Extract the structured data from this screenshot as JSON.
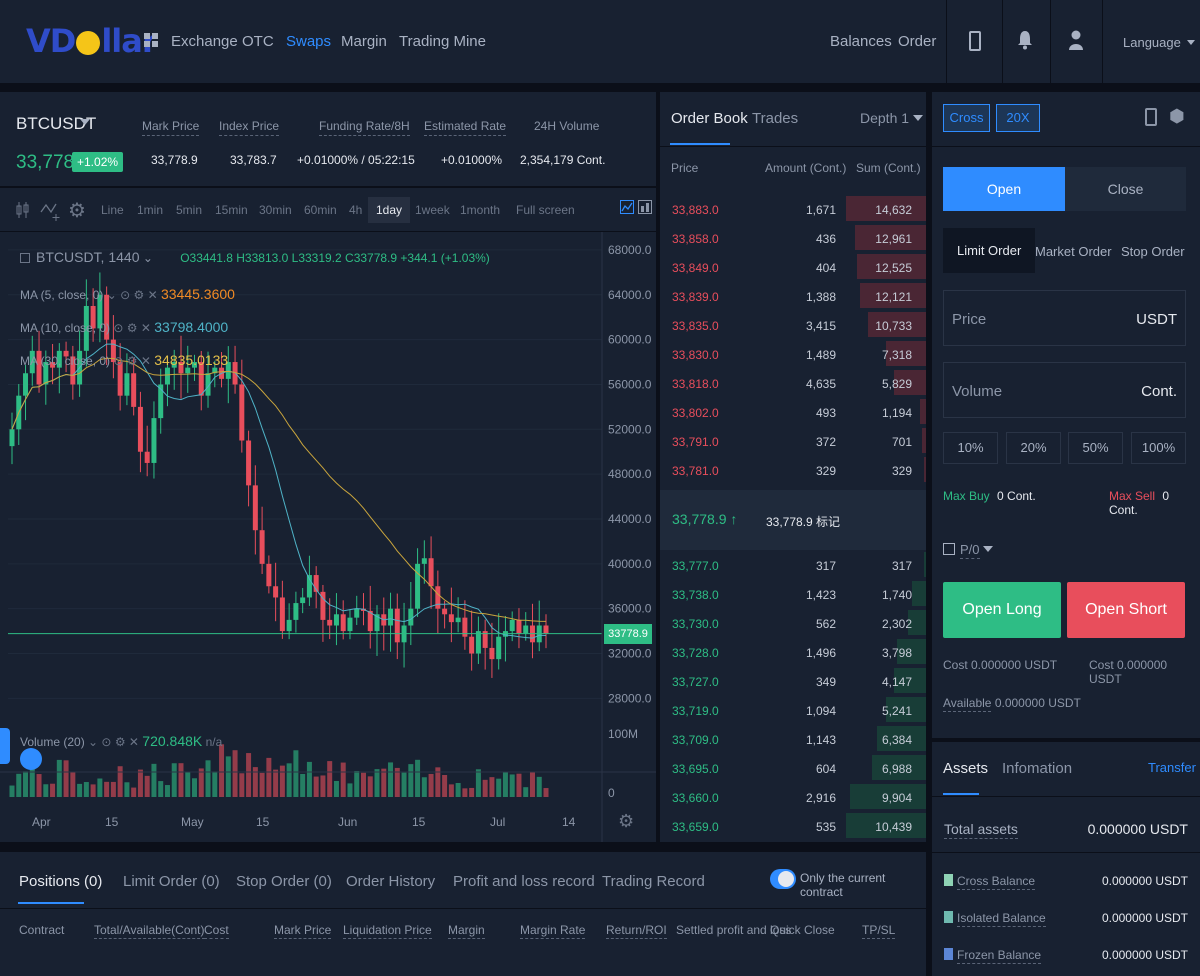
{
  "nav": {
    "logo_left": "VD",
    "logo_right": "llar",
    "links": [
      "Exchange",
      "OTC",
      "Swaps",
      "Margin",
      "Trading Mine"
    ],
    "active": "Swaps",
    "right_links": [
      "Balances",
      "Order"
    ],
    "language": "Language",
    "icons": [
      "grid-icon",
      "mobile-icon",
      "bell-icon",
      "user-icon",
      "caret-down-icon"
    ]
  },
  "ticker": {
    "symbol": "BTCUSDT",
    "last_price": "33,778.9",
    "change": "+1.02%",
    "stats": [
      {
        "label": "Mark Price",
        "value": "33,778.9"
      },
      {
        "label": "Index Price",
        "value": "33,783.7"
      },
      {
        "label": "Funding Rate/8H",
        "value": "+0.01000% / 05:22:15"
      },
      {
        "label": "Estimated Rate",
        "value": "+0.01000%"
      },
      {
        "label": "24H Volume",
        "value": "2,354,179 Cont."
      }
    ]
  },
  "chart_toolbar": {
    "intervals": [
      "Line",
      "1min",
      "5min",
      "15min",
      "30min",
      "60min",
      "4h",
      "1day",
      "1week",
      "1month",
      "Full screen"
    ],
    "active": "1day"
  },
  "chart_legend": {
    "title": "BTCUSDT, 1440",
    "ohlc": "O33441.8  H33813.0  L33319.2  C33778.9  +344.1 (+1.03%)",
    "ma5_label": "MA (5, close, 0)",
    "ma5_value": "33445.3600",
    "ma10_label": "MA (10, close, 0)",
    "ma10_value": "33798.4000",
    "ma30_label": "MA (30, close, 0)",
    "ma30_value": "34835.0133",
    "volume_label": "Volume (20)",
    "volume_value": "720.848K",
    "volume_extra": "n/a",
    "price_tag": "33778.9"
  },
  "chart_data": {
    "type": "candlestick",
    "y_ticks": [
      "68000.0",
      "64000.0",
      "60000.0",
      "56000.0",
      "52000.0",
      "48000.0",
      "44000.0",
      "40000.0",
      "36000.0",
      "32000.0",
      "28000.0"
    ],
    "ylim": [
      25000,
      69600
    ],
    "volume_ticks": [
      "100M",
      "0"
    ],
    "x_ticks": [
      "Apr",
      "15",
      "May",
      "15",
      "Jun",
      "15",
      "Jul",
      "14"
    ],
    "close_path": [
      52000,
      55000,
      57000,
      59000,
      56000,
      58000,
      57500,
      59000,
      58500,
      56000,
      59000,
      63000,
      61000,
      64000,
      60000,
      58000,
      55000,
      57000,
      54000,
      50000,
      49000,
      53000,
      56000,
      57500,
      58000,
      57000,
      57500,
      58000,
      55000,
      57000,
      57500,
      56500,
      58000,
      56000,
      51000,
      47000,
      43000,
      40000,
      38000,
      37000,
      34000,
      35000,
      36500,
      37000,
      39000,
      37500,
      35000,
      34500,
      35500,
      34000,
      35200,
      36000,
      35800,
      34000,
      35500,
      34500,
      36000,
      33000,
      34500,
      36000,
      40000,
      40500,
      38000,
      36000,
      35500,
      34800,
      35200,
      33500,
      32000,
      34000,
      32500,
      31500,
      33500,
      34000,
      35000,
      33800,
      34500,
      33000,
      34500,
      33778.9
    ]
  },
  "orderbook": {
    "tabs": [
      "Order Book",
      "Trades"
    ],
    "depth": "Depth 1",
    "headers": [
      "Price",
      "Amount (Cont.)",
      "Sum (Cont.)"
    ],
    "asks": [
      {
        "price": "33,883.0",
        "amount": "1,671",
        "sum": "14,632",
        "depth": 1.0
      },
      {
        "price": "33,858.0",
        "amount": "436",
        "sum": "12,961",
        "depth": 0.89
      },
      {
        "price": "33,849.0",
        "amount": "404",
        "sum": "12,525",
        "depth": 0.86
      },
      {
        "price": "33,839.0",
        "amount": "1,388",
        "sum": "12,121",
        "depth": 0.83
      },
      {
        "price": "33,835.0",
        "amount": "3,415",
        "sum": "10,733",
        "depth": 0.73
      },
      {
        "price": "33,830.0",
        "amount": "1,489",
        "sum": "7,318",
        "depth": 0.5
      },
      {
        "price": "33,818.0",
        "amount": "4,635",
        "sum": "5,829",
        "depth": 0.4
      },
      {
        "price": "33,802.0",
        "amount": "493",
        "sum": "1,194",
        "depth": 0.08
      },
      {
        "price": "33,791.0",
        "amount": "372",
        "sum": "701",
        "depth": 0.05
      },
      {
        "price": "33,781.0",
        "amount": "329",
        "sum": "329",
        "depth": 0.02
      }
    ],
    "mid_price": "33,778.9",
    "mid_mark": "33,778.9 标记",
    "bids": [
      {
        "price": "33,777.0",
        "amount": "317",
        "sum": "317",
        "depth": 0.03
      },
      {
        "price": "33,738.0",
        "amount": "1,423",
        "sum": "1,740",
        "depth": 0.17
      },
      {
        "price": "33,730.0",
        "amount": "562",
        "sum": "2,302",
        "depth": 0.22
      },
      {
        "price": "33,728.0",
        "amount": "1,496",
        "sum": "3,798",
        "depth": 0.36
      },
      {
        "price": "33,727.0",
        "amount": "349",
        "sum": "4,147",
        "depth": 0.4
      },
      {
        "price": "33,719.0",
        "amount": "1,094",
        "sum": "5,241",
        "depth": 0.5
      },
      {
        "price": "33,709.0",
        "amount": "1,143",
        "sum": "6,384",
        "depth": 0.61
      },
      {
        "price": "33,695.0",
        "amount": "604",
        "sum": "6,988",
        "depth": 0.67
      },
      {
        "price": "33,660.0",
        "amount": "2,916",
        "sum": "9,904",
        "depth": 0.95
      },
      {
        "price": "33,659.0",
        "amount": "535",
        "sum": "10,439",
        "depth": 1.0
      }
    ]
  },
  "order_form": {
    "margin_mode": "Cross",
    "leverage": "20X",
    "open": "Open",
    "close": "Close",
    "order_types": [
      "Limit Order",
      "Market Order",
      "Stop Order"
    ],
    "price_label": "Price",
    "price_unit": "USDT",
    "volume_label": "Volume",
    "volume_unit": "Cont.",
    "percents": [
      "10%",
      "20%",
      "50%",
      "100%"
    ],
    "max_buy_label": "Max Buy",
    "max_buy_value": "0 Cont.",
    "max_sell_label": "Max Sell",
    "max_sell_value": "0 Cont.",
    "po_label": "P/0",
    "open_long": "Open Long",
    "open_short": "Open Short",
    "cost_long": "Cost  0.000000 USDT",
    "cost_short": "Cost  0.000000 USDT",
    "available_label": "Available",
    "available_value": "0.000000 USDT"
  },
  "assets": {
    "tabs": [
      "Assets",
      "Infomation"
    ],
    "transfer": "Transfer",
    "total_label": "Total assets",
    "total_value": "0.000000 USDT",
    "rows": [
      {
        "label": "Cross Balance",
        "value": "0.000000 USDT",
        "color": "#8fd3b5"
      },
      {
        "label": "Isolated Balance",
        "value": "0.000000 USDT",
        "color": "#6fb9b0"
      },
      {
        "label": "Frozen Balance",
        "value": "0.000000 USDT",
        "color": "#5c86d6"
      }
    ]
  },
  "bottom": {
    "tabs": [
      "Positions (0)",
      "Limit Order (0)",
      "Stop Order (0)",
      "Order History",
      "Profit and loss record",
      "Trading Record"
    ],
    "toggle_label": "Only the current contract",
    "columns": [
      "Contract",
      "Total/Available(Cont)",
      "Cost",
      "Mark Price",
      "Liquidation Price",
      "Margin",
      "Margin Rate",
      "Return/ROI",
      "Settled profit and loss",
      "Quick Close",
      "TP/SL"
    ]
  },
  "colors": {
    "up": "#2ebd85",
    "down": "#e84e5c",
    "accent": "#2f8cff",
    "panel": "#182131",
    "bg": "#0b0f19"
  }
}
